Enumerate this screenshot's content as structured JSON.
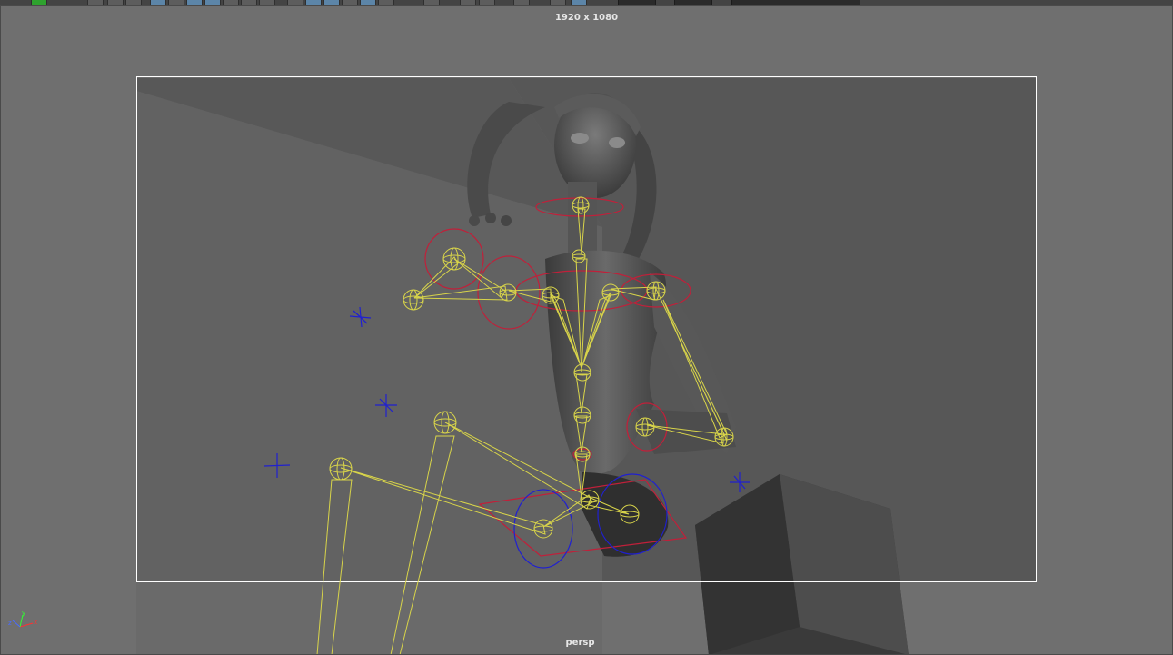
{
  "viewport": {
    "resolution_label": "1920 x 1080",
    "camera_label": "persp"
  },
  "axis_gizmo": {
    "x_label": "x",
    "y_label": "y",
    "z_label": "z",
    "x_color": "#ff3030",
    "y_color": "#30ff30",
    "z_color": "#4a6cff"
  },
  "colors": {
    "viewport_bg": "#707070",
    "joint_color": "#d8d44a",
    "nurbs_control_color": "#c0203a",
    "ik_handle_color": "#2020d0",
    "resolution_gate_color": "#ffffff",
    "toolbar_active": "#5c85a8"
  },
  "scene": {
    "character": "rigged character with skeleton joints",
    "props": [
      "floor plane",
      "box"
    ]
  }
}
